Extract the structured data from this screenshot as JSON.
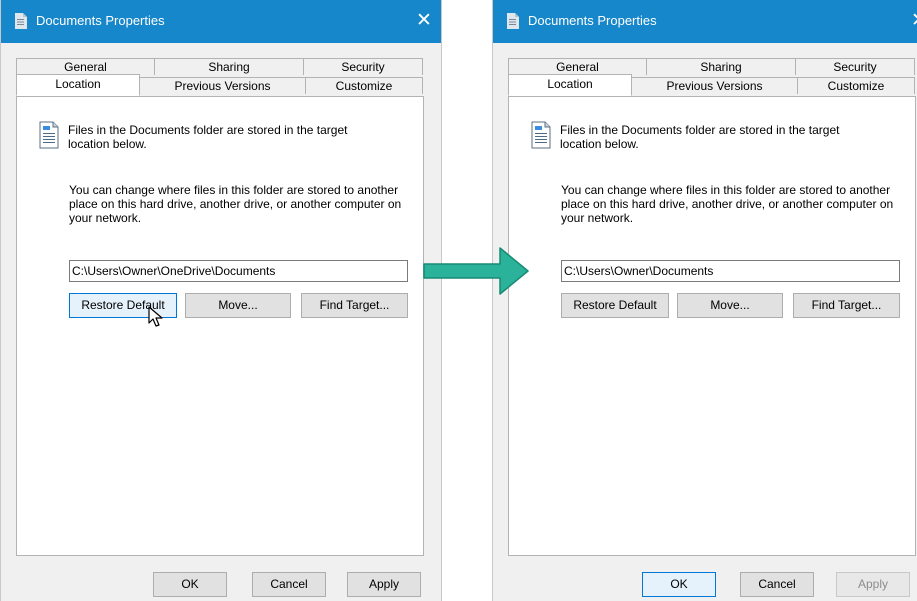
{
  "dialogs": [
    {
      "title": "Documents Properties",
      "tabs_row1": [
        "General",
        "Sharing",
        "Security"
      ],
      "tabs_row2": [
        "Location",
        "Previous Versions",
        "Customize"
      ],
      "info_text_1": "Files in the Documents folder are stored in the target location below.",
      "info_text_2": "You can change where files in this folder are stored to another place on this hard drive, another drive, or another computer on your network.",
      "path_value": "C:\\Users\\Owner\\OneDrive\\Documents",
      "restore_default_label": "Restore Default",
      "move_label": "Move...",
      "find_target_label": "Find Target...",
      "ok_label": "OK",
      "cancel_label": "Cancel",
      "apply_label": "Apply"
    },
    {
      "title": "Documents Properties",
      "tabs_row1": [
        "General",
        "Sharing",
        "Security"
      ],
      "tabs_row2": [
        "Location",
        "Previous Versions",
        "Customize"
      ],
      "info_text_1": "Files in the Documents folder are stored in the target location below.",
      "info_text_2": "You can change where files in this folder are stored to another place on this hard drive, another drive, or another computer on your network.",
      "path_value": "C:\\Users\\Owner\\Documents",
      "restore_default_label": "Restore Default",
      "move_label": "Move...",
      "find_target_label": "Find Target...",
      "ok_label": "OK",
      "cancel_label": "Cancel",
      "apply_label": "Apply"
    }
  ],
  "colors": {
    "title_bar": "#1687ca",
    "arrow": "#2ab39a",
    "focus_border": "#0078d7"
  },
  "icons": {
    "title": "document-folder-icon",
    "close": "close-icon",
    "panel": "document-icon",
    "cursor": "mouse-pointer-icon",
    "transition": "right-arrow-icon"
  }
}
